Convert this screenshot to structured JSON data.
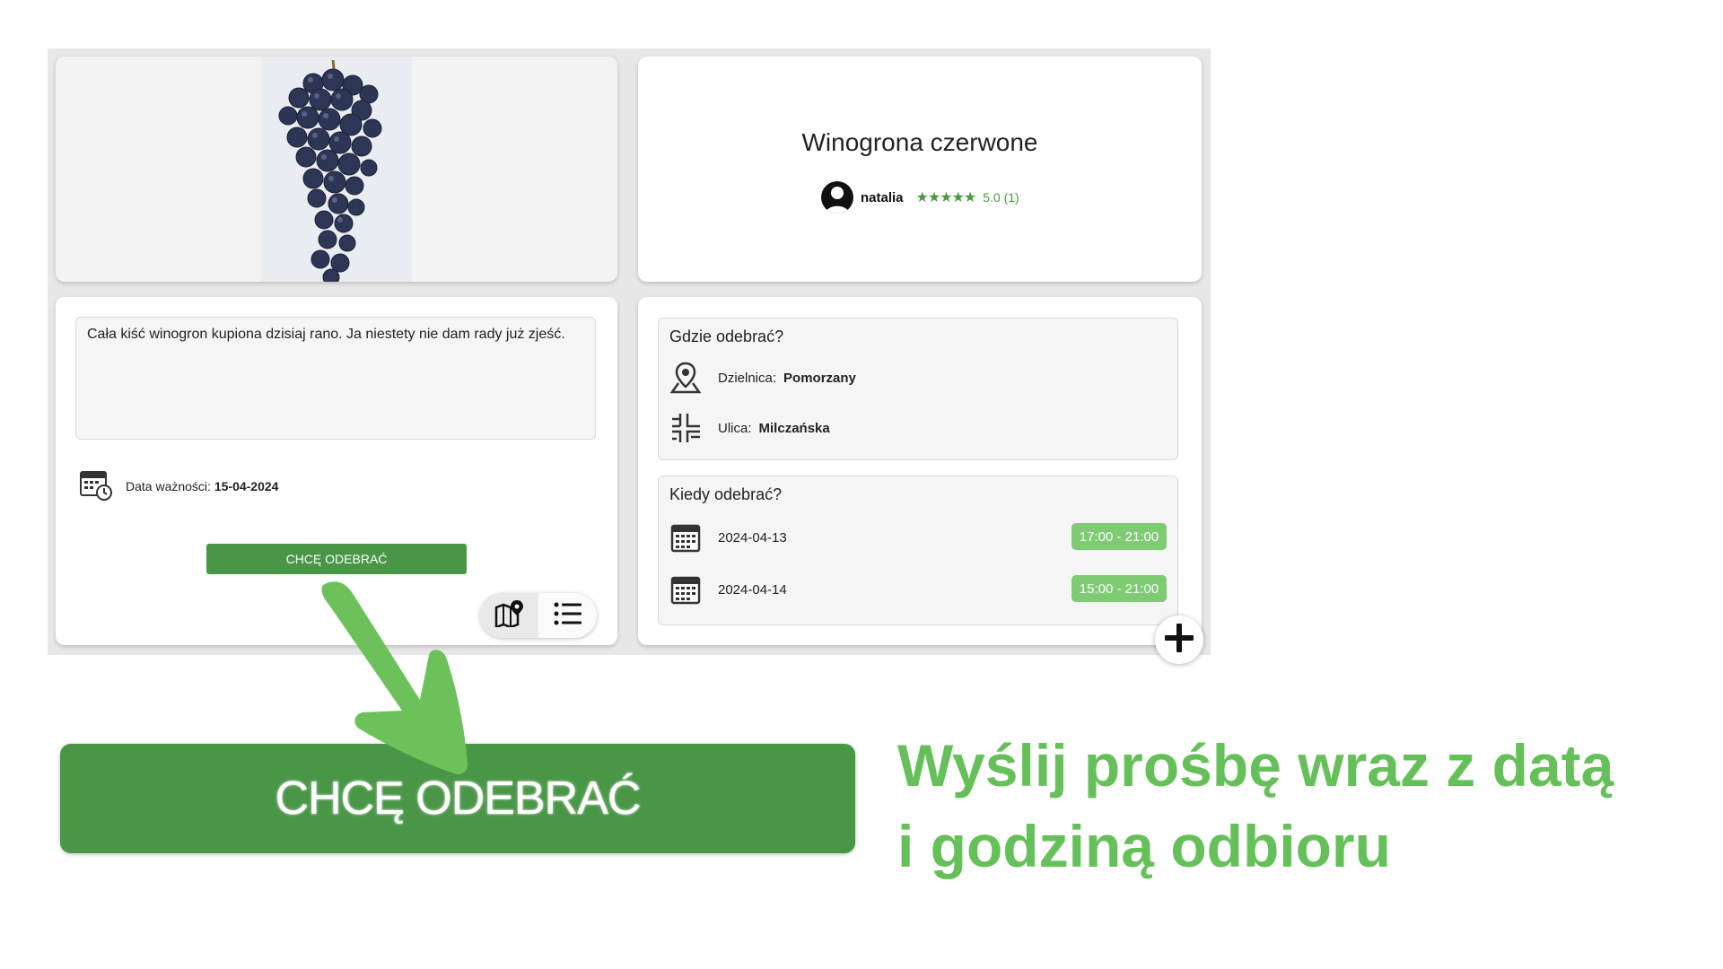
{
  "product": {
    "title": "Winogrona czerwone",
    "seller": "natalia",
    "stars": "★★★★★",
    "rating": "5.0 (1)",
    "description": "Cała kiść winogron kupiona dzisiaj rano. Ja niestety nie dam rady już zjeść.",
    "expiry_label": "Data ważności:",
    "expiry_value": "15-04-2024"
  },
  "actions": {
    "claim_label": "CHCĘ ODEBRAĆ"
  },
  "where": {
    "title": "Gdzie odebrać?",
    "district_label": "Dzielnica:",
    "district_value": "Pomorzany",
    "street_label": "Ulica:",
    "street_value": "Milczańska"
  },
  "when": {
    "title": "Kiedy odebrać?",
    "slots": [
      {
        "date": "2024-04-13",
        "time": "17:00 - 21:00"
      },
      {
        "date": "2024-04-14",
        "time": "15:00 - 21:00"
      }
    ]
  },
  "promo": {
    "button_label": "CHCĘ ODEBRAĆ",
    "caption_line1": "Wyślij prośbę wraz z datą",
    "caption_line2": "i godziną odbioru"
  },
  "colors": {
    "primary_green": "#4a9647",
    "accent_green": "#66c05a",
    "badge_green": "#7ecb74",
    "arrow_green": "#6cc15b"
  },
  "icons": {
    "map": "map-pin-icon",
    "street": "street-grid-icon",
    "calendar": "calendar-icon",
    "expiry": "calendar-clock-icon",
    "plus": "plus-icon",
    "map_view": "map-view-icon",
    "list_view": "list-view-icon"
  }
}
